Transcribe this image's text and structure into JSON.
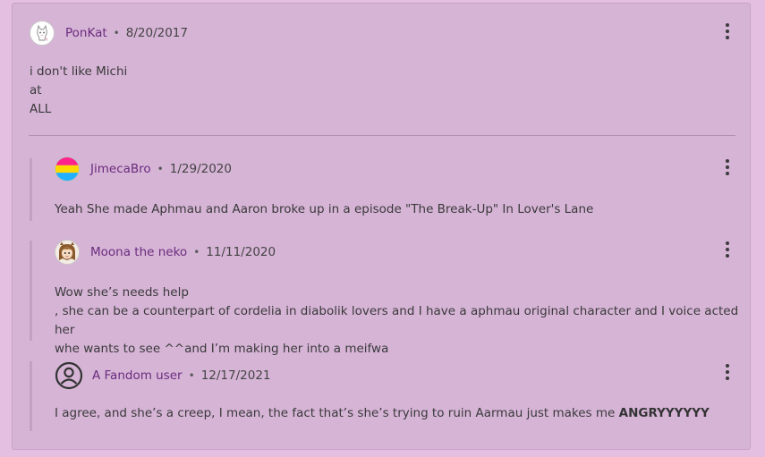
{
  "comment": {
    "username": "PonKat",
    "date": "8/20/2017",
    "lines": [
      "i don't like Michi",
      "at",
      "ALL"
    ]
  },
  "replies": [
    {
      "username": "JimecaBro",
      "date": "1/29/2020",
      "text": "Yeah She made Aphmau and Aaron broke up in a episode \"The Break-Up\" In Lover's Lane",
      "avatar_icon": "pansexual-flag-avatar"
    },
    {
      "username": "Moona the neko",
      "date": "11/11/2020",
      "lines": [
        "Wow she’s needs help",
        ", she can be a counterpart of cordelia in diabolik lovers and I have a aphmau original character and I voice acted her",
        "whe wants to see ^^and I’m making her into a meifwa"
      ],
      "avatar_icon": "drawn-character-avatar"
    },
    {
      "username": "A Fandom user",
      "date": "12/17/2021",
      "text_main": "I agree, and she’s a creep, I mean, the fact that’s she’s trying to ruin Aarmau just makes me ",
      "text_bold": "ANGRYYYYYY",
      "avatar_icon": "user-circle-icon"
    }
  ],
  "separator": "•",
  "colors": {
    "page_bg": "#e4bfe1",
    "card_bg": "#d6b4d6",
    "username": "#6a2c7e"
  }
}
